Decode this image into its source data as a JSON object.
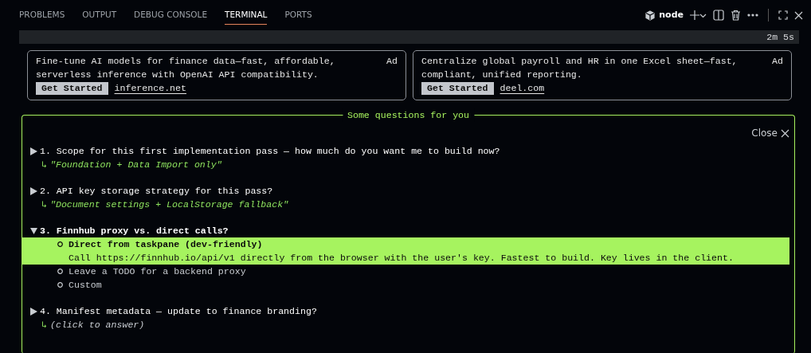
{
  "tabs": [
    {
      "label": "PROBLEMS",
      "selected": false
    },
    {
      "label": "OUTPUT",
      "selected": false
    },
    {
      "label": "DEBUG CONSOLE",
      "selected": false
    },
    {
      "label": "TERMINAL",
      "selected": true
    },
    {
      "label": "PORTS",
      "selected": false
    }
  ],
  "terminal": {
    "name": "node"
  },
  "status": {
    "elapsed": "2m 5s"
  },
  "ads": [
    {
      "text": "Fine-tune AI models for finance data—fast, affordable, serverless inference with OpenAI API compatibility.",
      "tag": "Ad",
      "button": "Get Started",
      "link": "inference.net"
    },
    {
      "text": "Centralize global payroll and HR in one Excel sheet—fast, compliant, unified reporting.",
      "tag": "Ad",
      "button": "Get Started",
      "link": "deel.com"
    }
  ],
  "questions_panel": {
    "title": "Some questions for you",
    "close": "Close",
    "questions": [
      {
        "title": "1. Scope for this first implementation pass — how much do you want me to build now?",
        "expanded": false,
        "answer": {
          "marker": "↳",
          "text": "\"Foundation + Data Import only\"",
          "kind": "answered"
        }
      },
      {
        "title": "2. API key storage strategy for this pass?",
        "expanded": false,
        "answer": {
          "marker": "↳",
          "text": "\"Document settings + LocalStorage fallback\"",
          "kind": "answered"
        }
      },
      {
        "title": "3. Finnhub proxy vs. direct calls?",
        "expanded": true,
        "options": [
          {
            "label": "Direct from taskpane (dev-friendly)",
            "description": "Call https://finnhub.io/api/v1 directly from the browser with the user's key. Fastest to build. Key lives in the client.",
            "selected": true
          },
          {
            "label": "Leave a TODO for a backend proxy",
            "selected": false
          },
          {
            "label": "Custom",
            "selected": false
          }
        ]
      },
      {
        "title": "4. Manifest metadata — update to finance branding?",
        "expanded": false,
        "answer": {
          "marker": "↳",
          "text": "(click to answer)",
          "kind": "pending"
        }
      }
    ]
  }
}
